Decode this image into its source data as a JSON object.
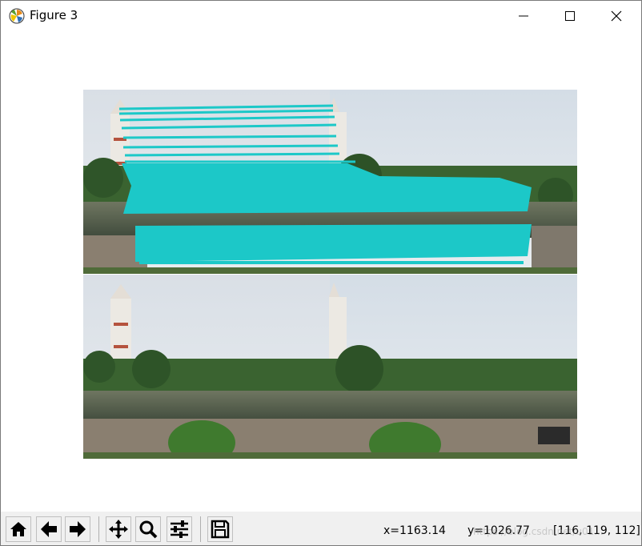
{
  "window": {
    "title": "Figure 3"
  },
  "toolbar": {
    "buttons": [
      {
        "name": "home-button",
        "icon": "home-icon"
      },
      {
        "name": "back-button",
        "icon": "arrow-left-icon"
      },
      {
        "name": "forward-button",
        "icon": "arrow-right-icon"
      },
      {
        "name": "pan-button",
        "icon": "move-icon"
      },
      {
        "name": "zoom-button",
        "icon": "magnifier-icon"
      },
      {
        "name": "subplots-button",
        "icon": "sliders-icon"
      },
      {
        "name": "save-button",
        "icon": "floppy-icon"
      }
    ]
  },
  "status": {
    "x": "x=1163.14",
    "y": "y=1026.77",
    "rgb": "[116, 119, 112]"
  },
  "watermark": "https://blog.csdn.net/u01...",
  "colors": {
    "match_lines": "#1cc8c8",
    "sky": "#dde3ea",
    "trees": "#2f5a2a",
    "water": "#4b5548"
  }
}
